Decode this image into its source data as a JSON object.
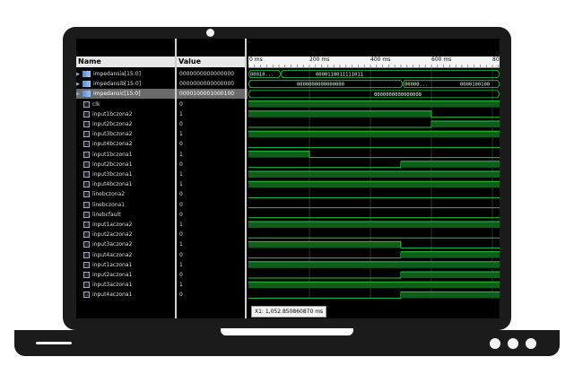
{
  "columns": {
    "name": "Name",
    "value": "Value"
  },
  "signals": [
    {
      "name": "impedansia[15:0]",
      "value": "0000000000000000",
      "kind": "bus",
      "expandable": true,
      "selected": false
    },
    {
      "name": "impedansib[15:0]",
      "value": "0000000000000000",
      "kind": "bus",
      "expandable": true,
      "selected": false
    },
    {
      "name": "impedansic[15:0]",
      "value": "0000100001000100",
      "kind": "bus",
      "expandable": true,
      "selected": true
    },
    {
      "name": "clk",
      "value": "0",
      "kind": "wire"
    },
    {
      "name": "input1bczona2",
      "value": "1",
      "kind": "wire"
    },
    {
      "name": "input2bczona2",
      "value": "0",
      "kind": "wire"
    },
    {
      "name": "input3bczona2",
      "value": "1",
      "kind": "wire"
    },
    {
      "name": "input4bczona2",
      "value": "0",
      "kind": "wire"
    },
    {
      "name": "input1bczona1",
      "value": "1",
      "kind": "wire"
    },
    {
      "name": "input2bczona1",
      "value": "0",
      "kind": "wire"
    },
    {
      "name": "input3bczona1",
      "value": "1",
      "kind": "wire"
    },
    {
      "name": "input4bczona1",
      "value": "1",
      "kind": "wire"
    },
    {
      "name": "linebczona2",
      "value": "0",
      "kind": "wire"
    },
    {
      "name": "linebczona1",
      "value": "0",
      "kind": "wire"
    },
    {
      "name": "linebcfault",
      "value": "0",
      "kind": "wire"
    },
    {
      "name": "input1aczona2",
      "value": "1",
      "kind": "wire"
    },
    {
      "name": "input2aczona2",
      "value": "0",
      "kind": "wire"
    },
    {
      "name": "input3aczona2",
      "value": "1",
      "kind": "wire"
    },
    {
      "name": "input4aczona2",
      "value": "0",
      "kind": "wire"
    },
    {
      "name": "input1aczona1",
      "value": "1",
      "kind": "wire"
    },
    {
      "name": "input2aczona1",
      "value": "0",
      "kind": "wire"
    },
    {
      "name": "input3aczona1",
      "value": "1",
      "kind": "wire"
    },
    {
      "name": "input4aczona1",
      "value": "0",
      "kind": "wire"
    }
  ],
  "timeline": {
    "ticks": [
      "0 ms",
      "200 ms",
      "400 ms",
      "600 ms",
      "80"
    ]
  },
  "bus_labels": [
    [
      "00010...",
      "0000110011111011"
    ],
    [
      "0000000000000000",
      "00000...",
      "0000100100"
    ],
    [
      "0000000000000000"
    ]
  ],
  "cursor": {
    "readout": "X1: 1,052.850860870 ms"
  },
  "colors": {
    "wave": "#21c93a",
    "wave_fill": "#0f5e1a",
    "bus": "#24d645",
    "grid": "#3a3a3a"
  }
}
